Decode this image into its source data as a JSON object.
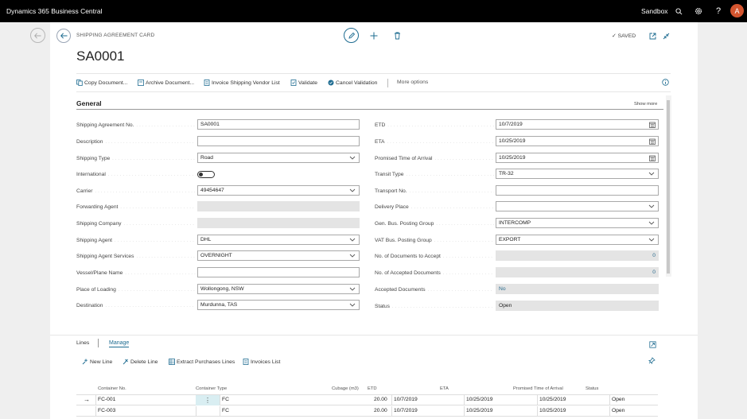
{
  "topbar": {
    "app_name": "Dynamics 365 Business Central",
    "environment": "Sandbox",
    "avatar_initial": "A"
  },
  "page": {
    "caption": "SHIPPING AGREEMENT CARD",
    "title": "SA0001",
    "saved_label": "SAVED"
  },
  "actions": {
    "copy_document": "Copy Document...",
    "archive_document": "Archive Document...",
    "invoice_vendor_list": "Invoice Shipping Vendor List",
    "validate": "Validate",
    "cancel_validation": "Cancel Validation",
    "more_options": "More options"
  },
  "general": {
    "heading": "General",
    "show_more": "Show more",
    "left": [
      {
        "label": "Shipping Agreement No.",
        "value": "SA0001"
      },
      {
        "label": "Description",
        "value": ""
      },
      {
        "label": "Shipping Type",
        "value": "Road"
      },
      {
        "label": "International",
        "value": "off"
      },
      {
        "label": "Carrier",
        "value": "49454647"
      },
      {
        "label": "Forwarding Agent",
        "value": ""
      },
      {
        "label": "Shipping Company",
        "value": ""
      },
      {
        "label": "Shipping Agent",
        "value": "DHL"
      },
      {
        "label": "Shipping Agent Services",
        "value": "OVERNIGHT"
      },
      {
        "label": "Vessel/Plane Name",
        "value": ""
      },
      {
        "label": "Place of Loading",
        "value": "Wollongong, NSW"
      },
      {
        "label": "Destination",
        "value": "Murdunna, TAS"
      }
    ],
    "right": [
      {
        "label": "ETD",
        "value": "10/7/2019"
      },
      {
        "label": "ETA",
        "value": "10/25/2019"
      },
      {
        "label": "Promised Time of Arrival",
        "value": "10/25/2019"
      },
      {
        "label": "Transit Type",
        "value": "TR-32"
      },
      {
        "label": "Transport No.",
        "value": ""
      },
      {
        "label": "Delivery Place",
        "value": ""
      },
      {
        "label": "Gen. Bus. Posting Group",
        "value": "INTERCOMP"
      },
      {
        "label": "VAT Bus. Posting Group",
        "value": "EXPORT"
      },
      {
        "label": "No. of Documents to Accept",
        "value": "0"
      },
      {
        "label": "No. of Accepted Documents",
        "value": "0"
      },
      {
        "label": "Accepted Documents",
        "value": "No"
      },
      {
        "label": "Status",
        "value": "Open"
      }
    ]
  },
  "lines": {
    "tab_lines": "Lines",
    "tab_manage": "Manage",
    "new_line": "New Line",
    "delete_line": "Delete Line",
    "extract_purchases": "Extract Purchases Lines",
    "invoices_list": "Invoices List",
    "columns": [
      "Container No.",
      "Container Type",
      "Cubage (m3)",
      "ETD",
      "ETA",
      "Promised Time of Arrival",
      "Status"
    ],
    "rows": [
      [
        "FC-001",
        "FC",
        "20.00",
        "10/7/2019",
        "10/25/2019",
        "10/25/2019",
        "Open"
      ],
      [
        "FC-003",
        "FC",
        "20.00",
        "10/7/2019",
        "10/25/2019",
        "10/25/2019",
        "Open"
      ]
    ]
  }
}
